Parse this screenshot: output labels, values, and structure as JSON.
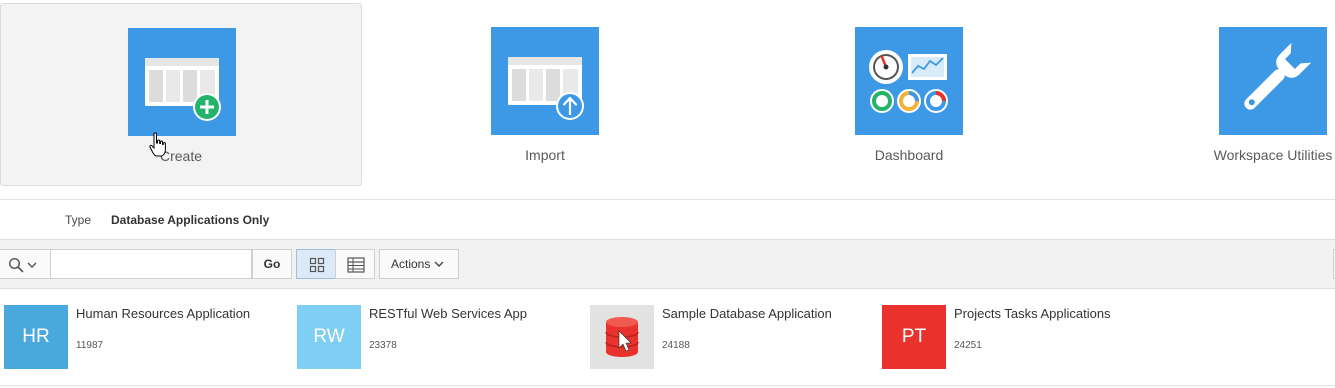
{
  "tiles": [
    {
      "label": "Create"
    },
    {
      "label": "Import"
    },
    {
      "label": "Dashboard"
    },
    {
      "label": "Workspace Utilities"
    }
  ],
  "filter": {
    "type_label": "Type",
    "type_value": "Database Applications Only"
  },
  "toolbar": {
    "search_placeholder": "",
    "search_value": "",
    "go_label": "Go",
    "actions_label": "Actions",
    "view_mode": "icons"
  },
  "apps": [
    {
      "initials": "HR",
      "name": "Human Resources Application",
      "id": "11987",
      "color": "#4aa9dc"
    },
    {
      "initials": "RW",
      "name": "RESTful Web Services App",
      "id": "23378",
      "color": "#7fcff5"
    },
    {
      "initials": "",
      "name": "Sample Database Application",
      "id": "24188",
      "color": "#e2e2e2",
      "icon": "database-cursor-icon"
    },
    {
      "initials": "PT",
      "name": "Projects Tasks Applications",
      "id": "24251",
      "color": "#e8322b"
    }
  ],
  "colors": {
    "tile_blue": "#3d99e6",
    "accent_green": "#23b36a"
  }
}
